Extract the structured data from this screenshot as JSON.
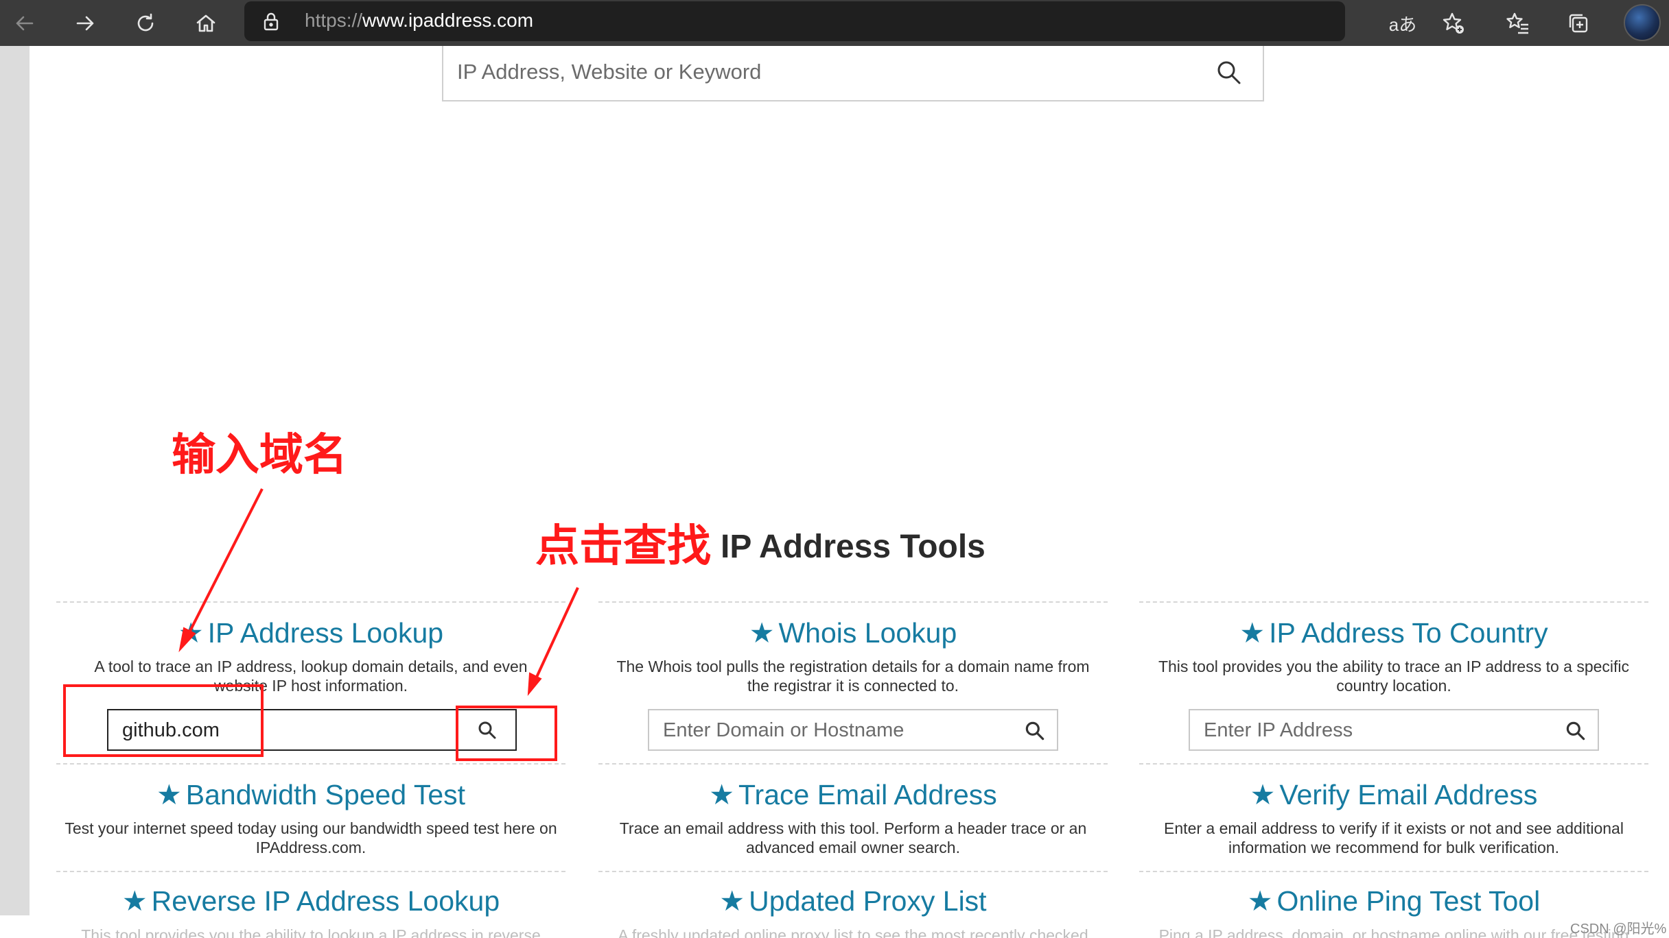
{
  "browser": {
    "url_scheme": "https://",
    "url_host": "www.ipaddress.com",
    "read_aloud_label": "aあ"
  },
  "top_search": {
    "placeholder": "IP Address, Website or Keyword"
  },
  "section_title": "IP Address Tools",
  "tools": [
    {
      "title": "IP Address Lookup",
      "desc": "A tool to trace an IP address, lookup domain details, and even website IP host information.",
      "input_value": "github.com",
      "placeholder": ""
    },
    {
      "title": "Whois Lookup",
      "desc": "The Whois tool pulls the registration details for a domain name from the registrar it is connected to.",
      "placeholder": "Enter Domain or Hostname"
    },
    {
      "title": "IP Address To Country",
      "desc": "This tool provides you the ability to trace an IP address to a specific country location.",
      "placeholder": "Enter IP Address"
    },
    {
      "title": "Bandwidth Speed Test",
      "desc": "Test your internet speed today using our bandwidth speed test here on IPAddress.com."
    },
    {
      "title": "Trace Email Address",
      "desc": "Trace an email address with this tool. Perform a header trace or an advanced email owner search."
    },
    {
      "title": "Verify Email Address",
      "desc": "Enter a email address to verify if it exists or not and see additional information we recommend for bulk verification."
    },
    {
      "title": "Reverse IP Address Lookup",
      "desc": "This tool provides you the ability to lookup a IP address in reverse"
    },
    {
      "title": "Updated Proxy List",
      "desc": "A freshly updated online proxy list to see the most recently checked"
    },
    {
      "title": "Online Ping Test Tool",
      "desc": "Ping a IP address, domain, or hostname online with our free testing"
    }
  ],
  "star": "★",
  "annotations": {
    "input_hint": "输入域名",
    "click_hint": "点击查找"
  },
  "watermark": "CSDN @阳光%",
  "colors": {
    "link": "#167ba1",
    "annotation": "#ff1a1a",
    "chrome": "#3b3b3b"
  }
}
